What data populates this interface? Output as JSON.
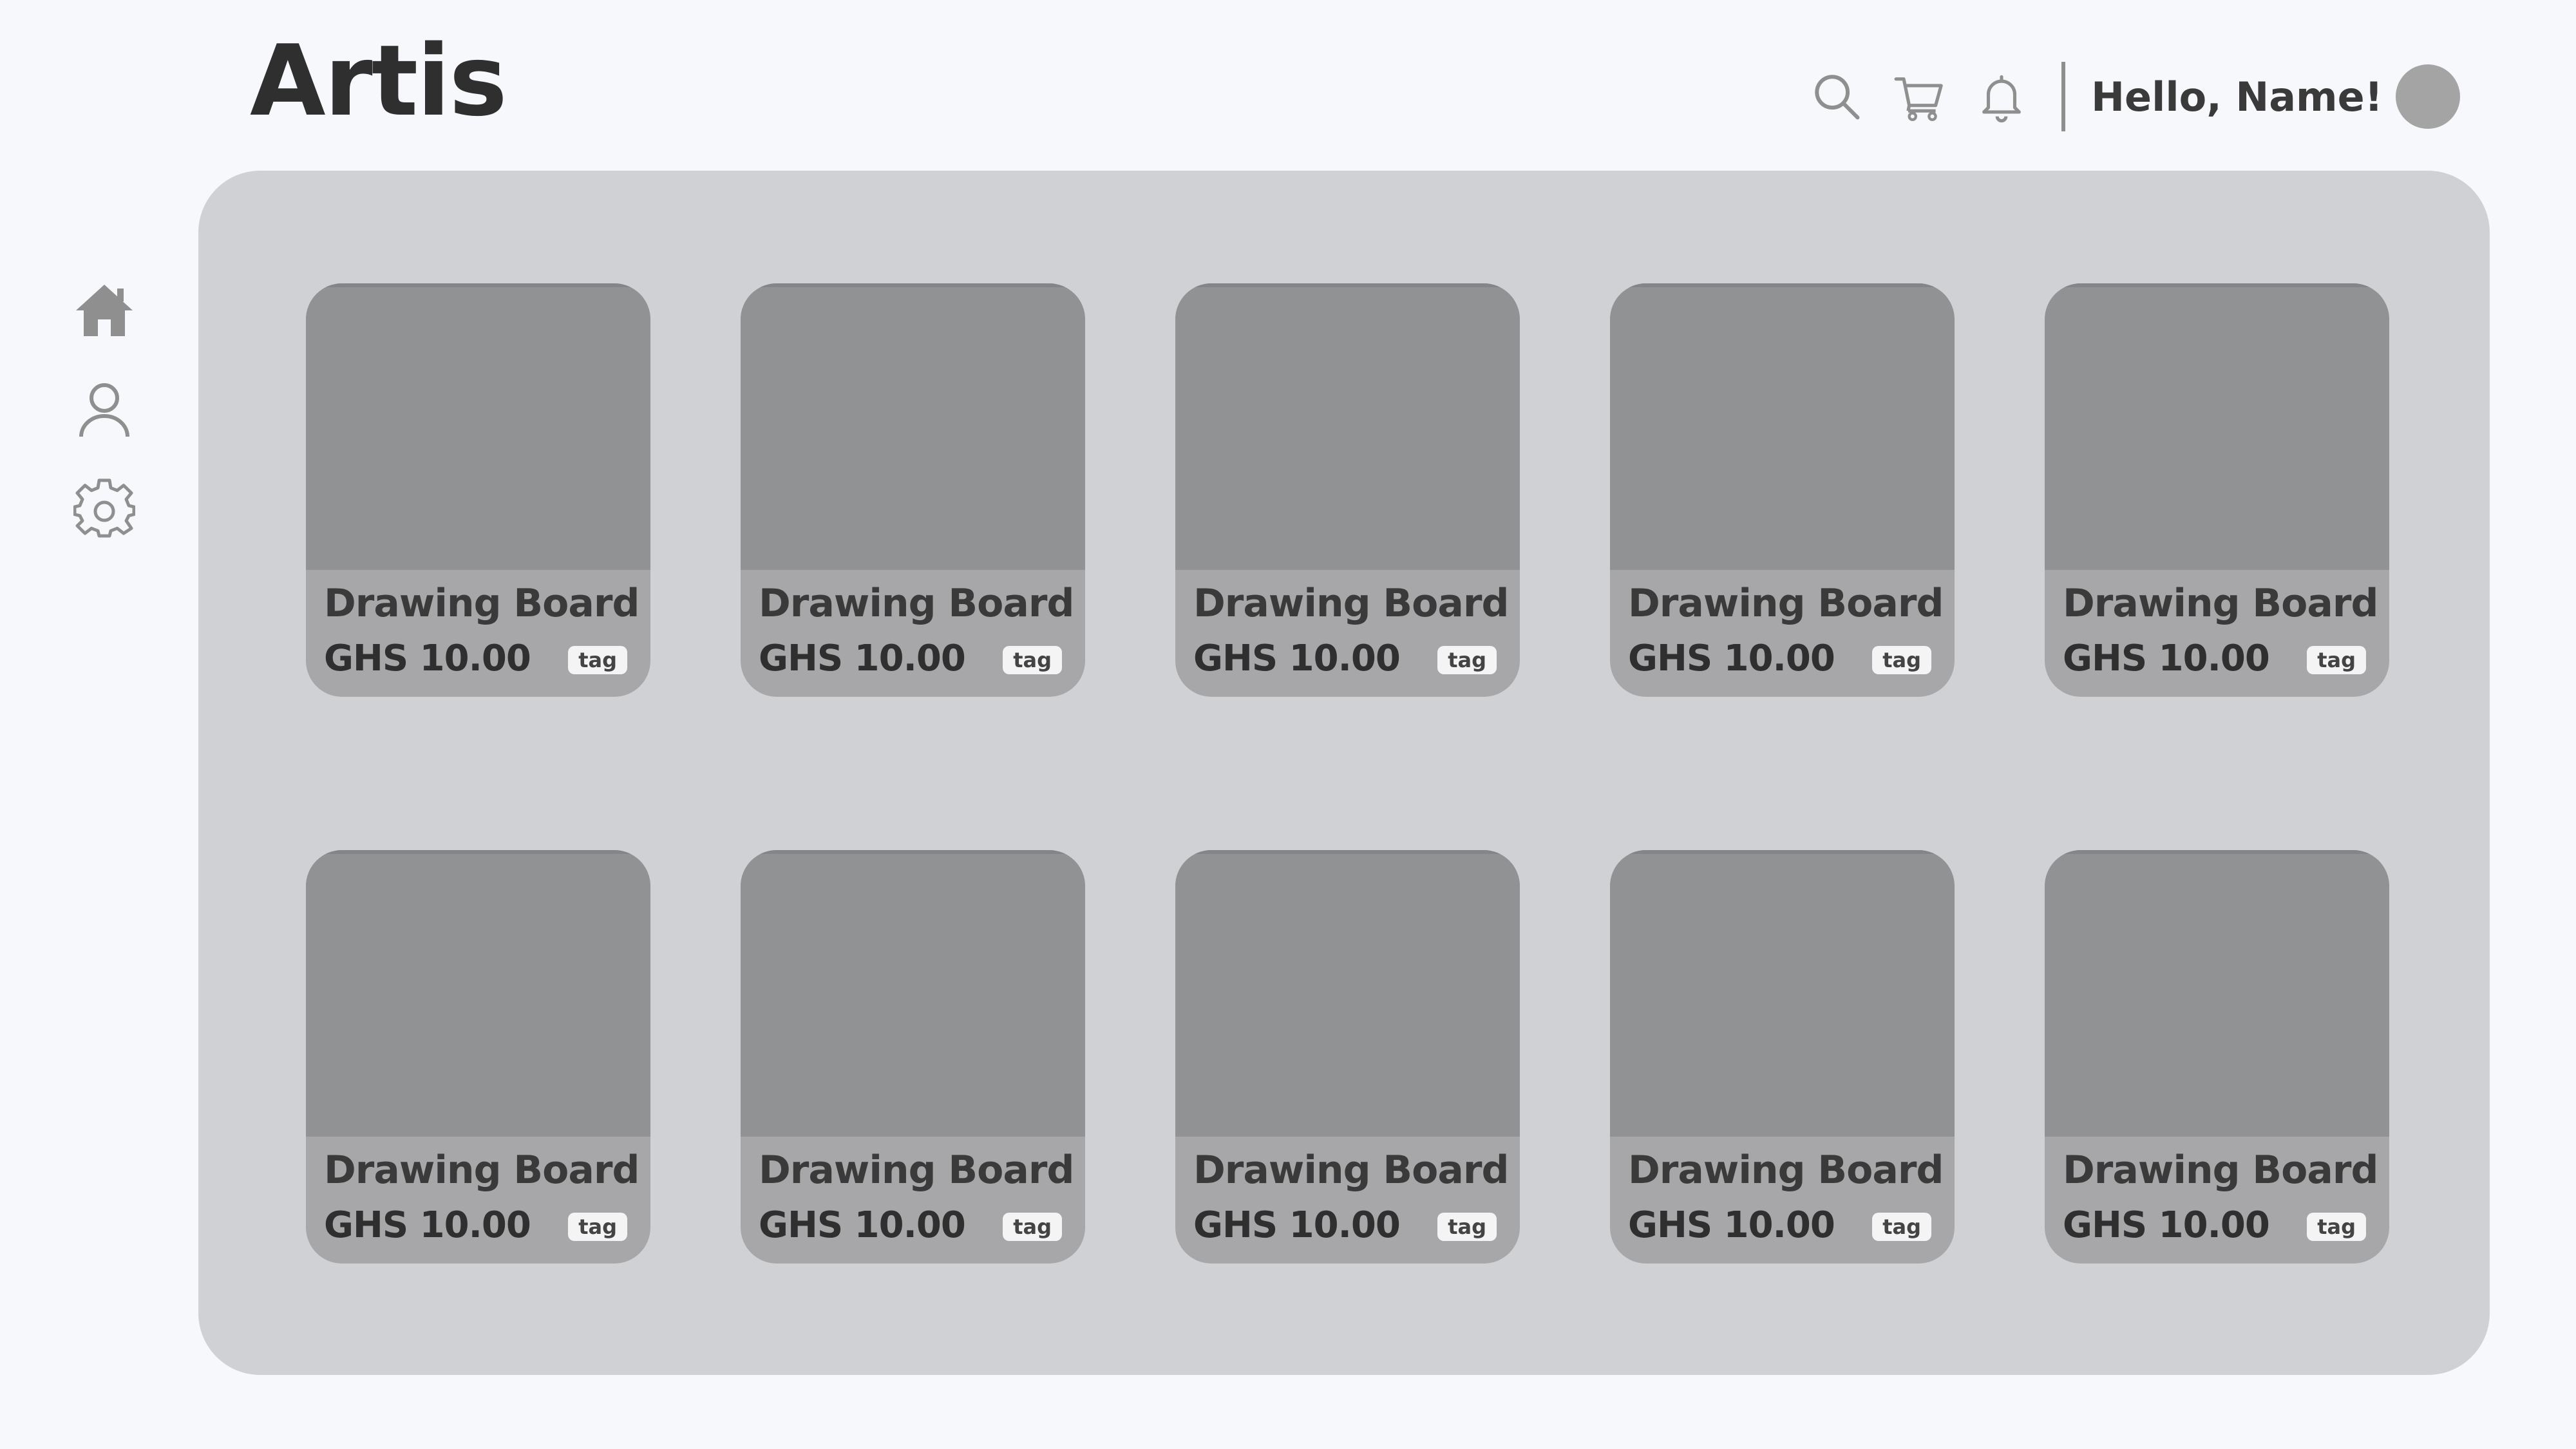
{
  "app": {
    "title": "Artis"
  },
  "header": {
    "icons": [
      "search-icon",
      "cart-icon",
      "bell-icon"
    ],
    "greeting": "Hello, Name!"
  },
  "sidebar": {
    "items": [
      {
        "name": "home",
        "icon": "home-icon"
      },
      {
        "name": "profile",
        "icon": "user-icon"
      },
      {
        "name": "settings",
        "icon": "gear-icon"
      }
    ]
  },
  "products": [
    {
      "title": "Drawing Board",
      "price": "GHS 10.00",
      "tag": "tag"
    },
    {
      "title": "Drawing Board",
      "price": "GHS 10.00",
      "tag": "tag"
    },
    {
      "title": "Drawing Board",
      "price": "GHS 10.00",
      "tag": "tag"
    },
    {
      "title": "Drawing Board",
      "price": "GHS 10.00",
      "tag": "tag"
    },
    {
      "title": "Drawing Board",
      "price": "GHS 10.00",
      "tag": "tag"
    },
    {
      "title": "Drawing Board",
      "price": "GHS 10.00",
      "tag": "tag"
    },
    {
      "title": "Drawing Board",
      "price": "GHS 10.00",
      "tag": "tag"
    },
    {
      "title": "Drawing Board",
      "price": "GHS 10.00",
      "tag": "tag"
    },
    {
      "title": "Drawing Board",
      "price": "GHS 10.00",
      "tag": "tag"
    },
    {
      "title": "Drawing Board",
      "price": "GHS 10.00",
      "tag": "tag"
    }
  ],
  "colors": {
    "background": "#f6f8fc",
    "panel": "#d0d1d5",
    "card": "#a7a7a9",
    "card_image": "#919294",
    "icon": "#8f8f8f"
  }
}
